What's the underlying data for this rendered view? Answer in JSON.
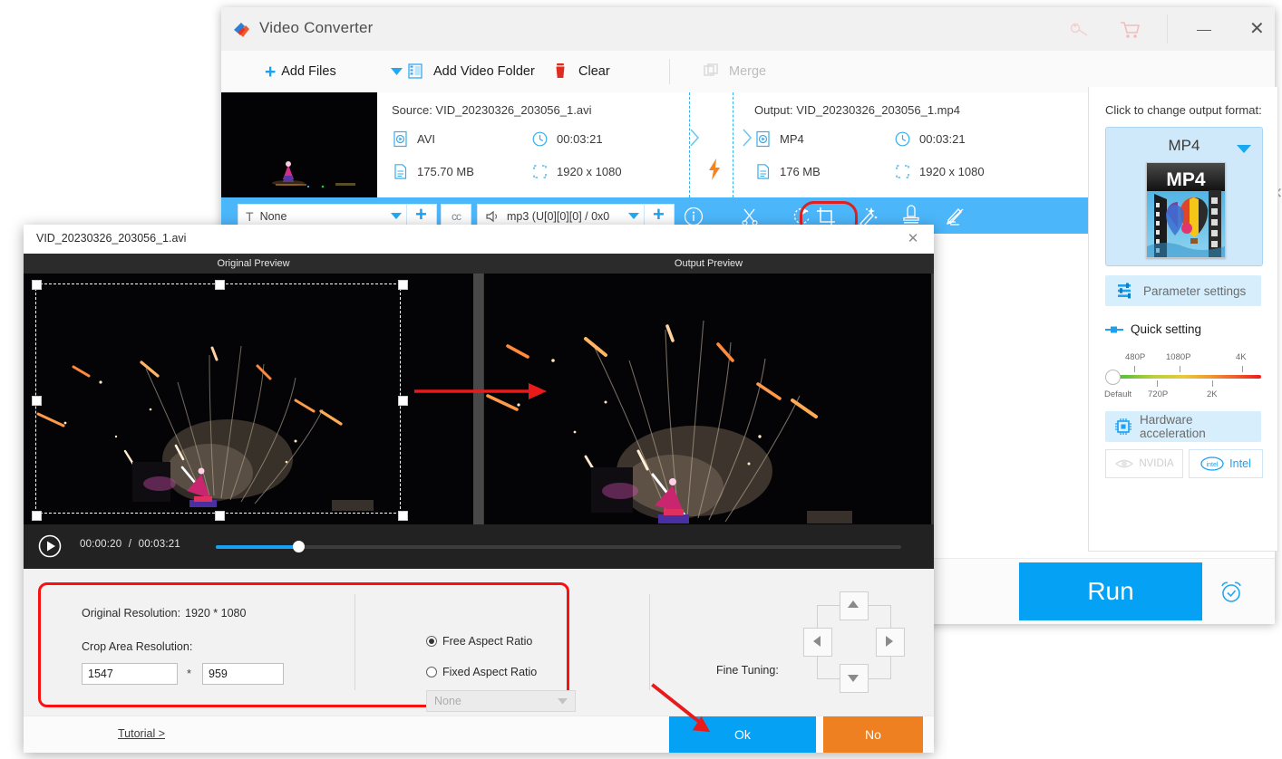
{
  "window": {
    "title": "Video Converter",
    "icons": {
      "key": "key-icon",
      "cart": "cart-icon",
      "minimize": "minimize-icon",
      "close": "close-icon"
    }
  },
  "toolbar": {
    "add_files": "Add Files",
    "add_video_folder": "Add Video Folder",
    "clear": "Clear",
    "merge": "Merge"
  },
  "file_row": {
    "source_label": "Source: VID_20230326_203056_1.avi",
    "output_label": "Output: VID_20230326_203056_1.mp4",
    "source": {
      "format": "AVI",
      "duration": "00:03:21",
      "size": "175.70 MB",
      "resolution": "1920 x 1080"
    },
    "output": {
      "format": "MP4",
      "duration": "00:03:21",
      "size": "176 MB",
      "resolution": "1920 x 1080"
    }
  },
  "action_bar": {
    "subtitle_value": "None",
    "audio_value": "mp3 (U[0][0][0] / 0x0",
    "cc_label": "cc",
    "icons": [
      "info-icon",
      "cut-icon",
      "rotate-icon",
      "crop-icon",
      "effect-icon",
      "watermark-icon",
      "edit-icon"
    ],
    "highlighted_icon": "crop-icon"
  },
  "right_panel": {
    "prompt": "Click to change output format:",
    "format": "MP4",
    "thumb_label": "MP4",
    "parameter_settings": "Parameter settings",
    "quick_setting": "Quick setting",
    "slider": {
      "top_ticks": [
        "480P",
        "1080P",
        "4K"
      ],
      "bottom_ticks": [
        "720P",
        "2K"
      ],
      "start_label": "Default",
      "value": "Default"
    },
    "hardware_acceleration": "Hardware acceleration",
    "nvidia": "NVIDIA",
    "intel": "Intel"
  },
  "run_bar": {
    "run": "Run",
    "alarm": "alarm-icon"
  },
  "crop_dialog": {
    "title": "VID_20230326_203056_1.avi",
    "original_preview": "Original Preview",
    "output_preview": "Output Preview",
    "player": {
      "current_time": "00:00:20",
      "separator": "/",
      "total_time": "00:03:21",
      "progress_percent": 12
    },
    "settings": {
      "original_resolution_label": "Original Resolution:",
      "original_resolution_value": "1920 * 1080",
      "crop_area_label": "Crop Area Resolution:",
      "crop_width": "1547",
      "crop_multiply": "*",
      "crop_height": "959",
      "free_aspect_ratio": "Free Aspect Ratio",
      "fixed_aspect_ratio": "Fixed Aspect Ratio",
      "fixed_ratio_value": "None",
      "selected_ratio_mode": "Free Aspect Ratio",
      "fine_tuning_label": "Fine Tuning:"
    },
    "footer": {
      "tutorial": "Tutorial >",
      "ok": "Ok",
      "no": "No"
    }
  },
  "colors": {
    "accent_blue": "#05a1f4",
    "bar_blue": "#4cb6fa",
    "orange": "#ef8022",
    "highlight_red": "#e02020",
    "arrow_red": "#e81a1a"
  }
}
